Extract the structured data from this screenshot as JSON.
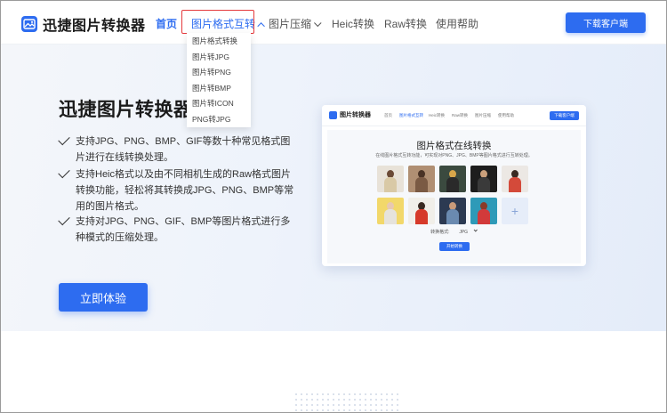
{
  "app": {
    "name": "迅捷图片转换器"
  },
  "header": {
    "nav": [
      {
        "label": "首页"
      },
      {
        "label": "图片格式互转"
      },
      {
        "label": "图片压缩"
      },
      {
        "label": "Heic转换"
      },
      {
        "label": "Raw转换"
      },
      {
        "label": "使用帮助"
      }
    ],
    "download_label": "下载客户端"
  },
  "dropdown": {
    "items": [
      {
        "label": "图片格式转换"
      },
      {
        "label": "图片转JPG"
      },
      {
        "label": "图片转PNG"
      },
      {
        "label": "图片转BMP"
      },
      {
        "label": "图片转ICON"
      },
      {
        "label": "PNG转JPG"
      }
    ]
  },
  "hero": {
    "title": "迅捷图片转换器",
    "features": [
      {
        "text": "支持JPG、PNG、BMP、GIF等数十种常见格式图片进行在线转换处理。"
      },
      {
        "text": "支持Heic格式以及由不同相机生成的Raw格式图片转换功能，轻松将其转换成JPG、PNG、BMP等常用的图片格式。"
      },
      {
        "text": "支持对JPG、PNG、GIF、BMP等图片格式进行多种模式的压缩处理。"
      }
    ],
    "cta_label": "立即体验"
  },
  "preview": {
    "logo_text": "图片转换器",
    "nav": [
      "首页",
      "图片格式互转",
      "Heic转换",
      "Raw转换",
      "图片压缩",
      "使用帮助"
    ],
    "download_label": "下载客户端",
    "title": "图片格式在线转换",
    "subtitle": "在线图片格式互转功能，可实现对PNG、JPG、BMP等图片格式进行互转处理。",
    "format_label": "转换格式:",
    "format_value": "JPG",
    "start_label": "开始转换",
    "add_symbol": "+"
  },
  "colors": {
    "accent": "#2d6cf0",
    "highlight": "#e4393c"
  }
}
